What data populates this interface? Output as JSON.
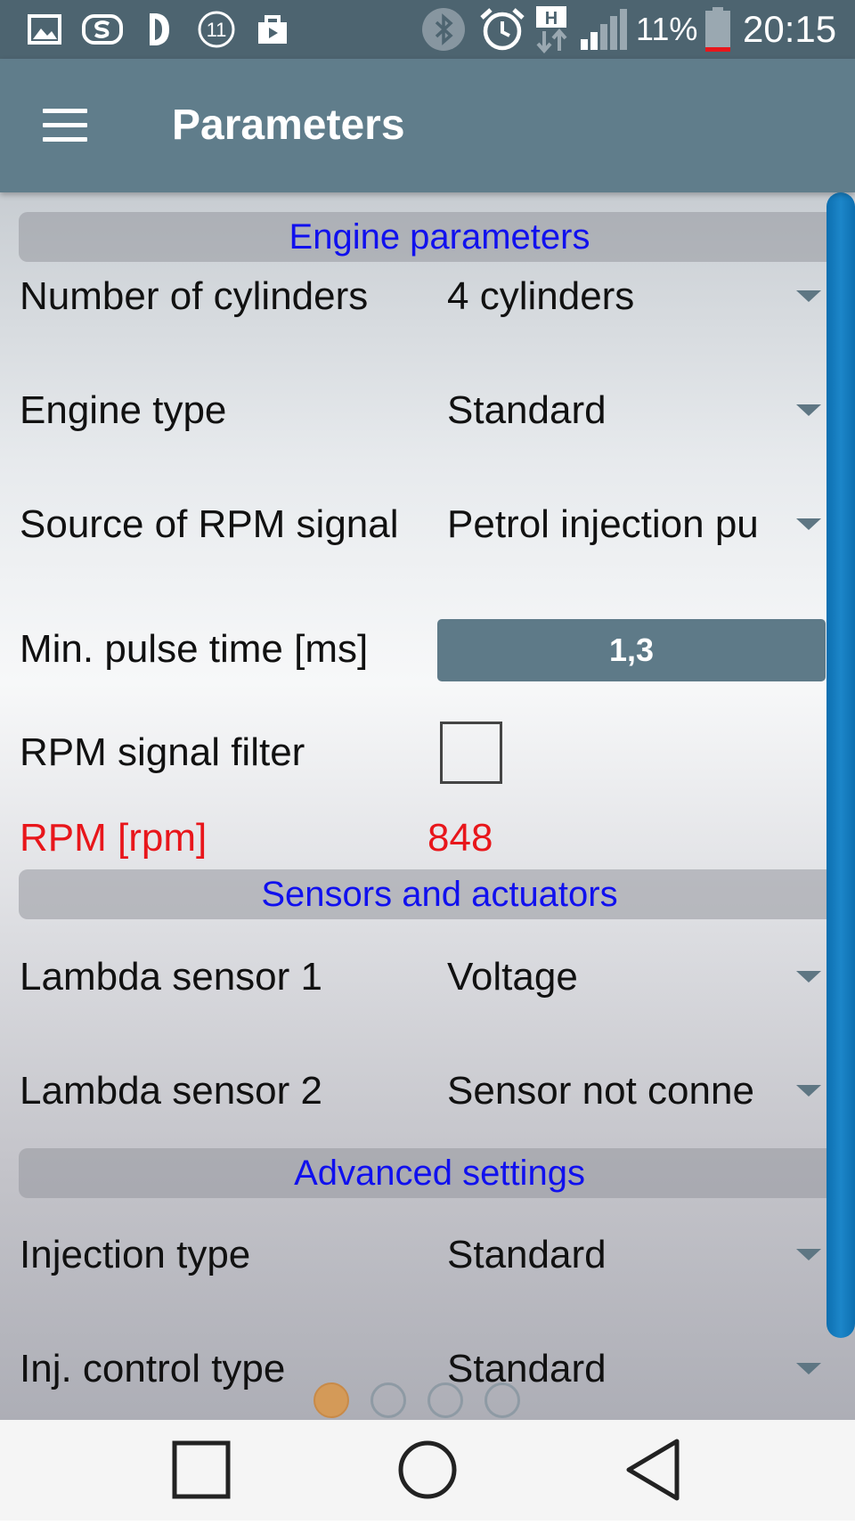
{
  "status_bar": {
    "battery_percent": "11%",
    "time": "20:15",
    "notification_icons": [
      "gallery-icon",
      "s-app-icon",
      "d-app-icon",
      "badge-11-icon",
      "store-bag-icon"
    ],
    "status_icons": [
      "bluetooth-icon",
      "alarm-icon",
      "hspa-data-icon",
      "signal-icon",
      "battery-icon"
    ],
    "notification_badge": "11",
    "data_badge": "H"
  },
  "app_bar": {
    "title": "Parameters",
    "menu_icon": "hamburger-menu-icon"
  },
  "sections": {
    "engine": {
      "title": "Engine parameters"
    },
    "sensors": {
      "title": "Sensors and actuators"
    },
    "advanced": {
      "title": "Advanced settings"
    }
  },
  "fields": {
    "cylinders": {
      "label": "Number of cylinders",
      "value": "4 cylinders"
    },
    "engine_type": {
      "label": "Engine type",
      "value": "Standard"
    },
    "rpm_source": {
      "label": "Source of RPM signal",
      "value": "Petrol injection pu"
    },
    "min_pulse": {
      "label": "Min. pulse time [ms]",
      "value": "1,3"
    },
    "rpm_filter": {
      "label": "RPM signal filter",
      "checked": false
    },
    "rpm": {
      "label": "RPM [rpm]",
      "value": "848"
    },
    "lambda1": {
      "label": "Lambda sensor 1",
      "value": "Voltage"
    },
    "lambda2": {
      "label": "Lambda sensor 2",
      "value": "Sensor not conne"
    },
    "injection_type": {
      "label": "Injection type",
      "value": "Standard"
    },
    "inj_control": {
      "label": "Inj. control type",
      "value": "Standard"
    }
  },
  "pager": {
    "page_count": 4,
    "current_page": 1
  },
  "nav_bar": {
    "buttons": [
      "recent-apps-icon",
      "home-icon",
      "back-icon"
    ]
  },
  "colors": {
    "app_bar": "#607d8b",
    "status_bar": "#4d6470",
    "section_title": "#1010ee",
    "live_value": "#e8161b",
    "scrollbar": "#1c86c9",
    "active_dot": "#d49a58"
  }
}
